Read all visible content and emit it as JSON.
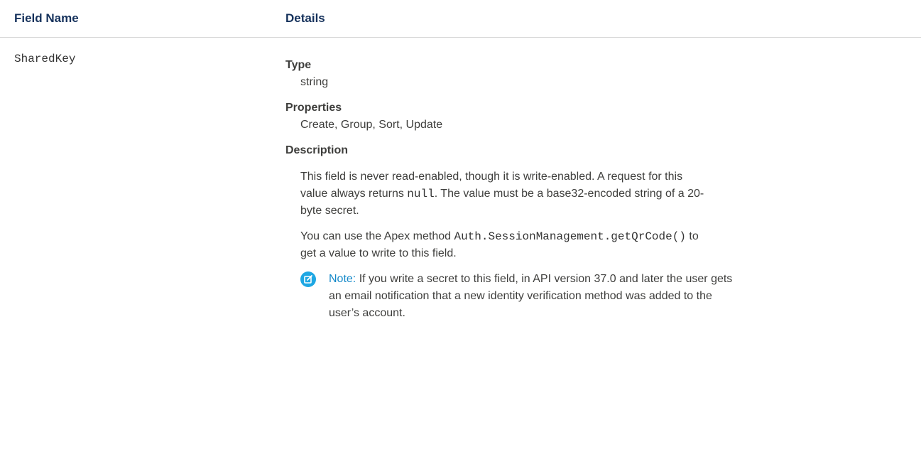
{
  "header": {
    "field_name": "Field Name",
    "details": "Details"
  },
  "row": {
    "field_name": "SharedKey",
    "type_label": "Type",
    "type_value": "string",
    "properties_label": "Properties",
    "properties_value": "Create, Group, Sort, Update",
    "description_label": "Description",
    "desc_p1_before": "This field is never read-enabled, though it is write-enabled. A request for this value always returns ",
    "desc_p1_code": "null",
    "desc_p1_after": ". The value must be a base32-encoded string of a 20-byte secret.",
    "desc_p2_before": "You can use the Apex method ",
    "desc_p2_code": "Auth.SessionManagement.getQrCode()",
    "desc_p2_after": " to get a value to write to this field.",
    "note_icon": "edit-note-icon",
    "note_label": "Note:",
    "note_text": " If you write a secret to this field, in API version 37.0 and later the user gets an email notification that a new identity verification method was added to the user’s account."
  },
  "colors": {
    "heading": "#16325c",
    "text": "#3e3e3c",
    "note_icon": "#1ea7e3",
    "note_label": "#1589c9",
    "divider": "#d4d4d4"
  }
}
